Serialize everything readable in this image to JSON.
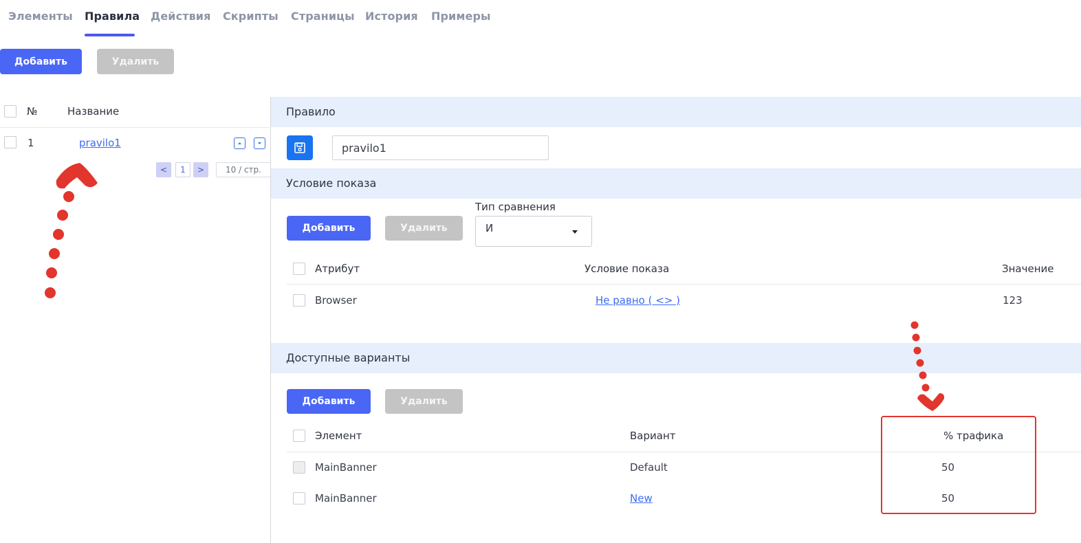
{
  "tabs": [
    {
      "label": "Элементы"
    },
    {
      "label": "Правила",
      "active": true
    },
    {
      "label": "Действия"
    },
    {
      "label": "Скрипты"
    },
    {
      "label": "Страницы"
    },
    {
      "label": "История"
    },
    {
      "label": "Примеры"
    }
  ],
  "toolbar": {
    "add_label": "Добавить",
    "delete_label": "Удалить"
  },
  "rules_list": {
    "col_number": "№",
    "col_name": "Название",
    "rows": [
      {
        "number": "1",
        "name": "pravilo1"
      }
    ],
    "pagination": {
      "prev": "<",
      "page": "1",
      "next": ">",
      "page_size": "10 / стр."
    }
  },
  "rule_panel": {
    "section_title": "Правило",
    "name_value": "pravilo1"
  },
  "condition_section": {
    "title": "Условие показа",
    "add_label": "Добавить",
    "delete_label": "Удалить",
    "comparison_label": "Тип сравнения",
    "comparison_value": "И",
    "columns": {
      "attribute": "Атрибут",
      "condition": "Условие показа",
      "value": "Значение"
    },
    "rows": [
      {
        "attribute": "Browser",
        "condition": "Не равно ( <> )",
        "value": "123"
      }
    ]
  },
  "variants_section": {
    "title": "Доступные варианты",
    "add_label": "Добавить",
    "delete_label": "Удалить",
    "columns": {
      "element": "Элемент",
      "variant": "Вариант",
      "traffic": "% трафика"
    },
    "rows": [
      {
        "element": "MainBanner",
        "variant": "Default",
        "traffic": "50"
      },
      {
        "element": "MainBanner",
        "variant": "New",
        "traffic": "50"
      }
    ]
  },
  "colors": {
    "accent": "#4a66f4",
    "save": "#1a73f0",
    "section_bg": "#e6effb",
    "annotation": "#e2352d"
  }
}
